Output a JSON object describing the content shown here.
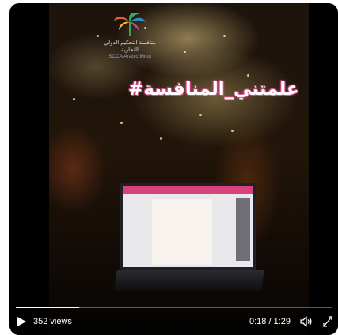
{
  "logo": {
    "arabic_text": "منافسة التحكيم الدولي التجارية",
    "english_text": "SCCA Arabic Moot"
  },
  "hashtag_text": "#علمتني_المنافسة",
  "player": {
    "views": "352 views",
    "time": "0:18 / 1:29",
    "progress_fraction": 0.2,
    "play_icon": "play-icon",
    "volume_icon": "volume-icon",
    "fullscreen_icon": "fullscreen-icon"
  },
  "colors": {
    "hashtag_outline": "#d44a86",
    "laptop_bar": "#d9437c",
    "progress": "#ffffff"
  }
}
